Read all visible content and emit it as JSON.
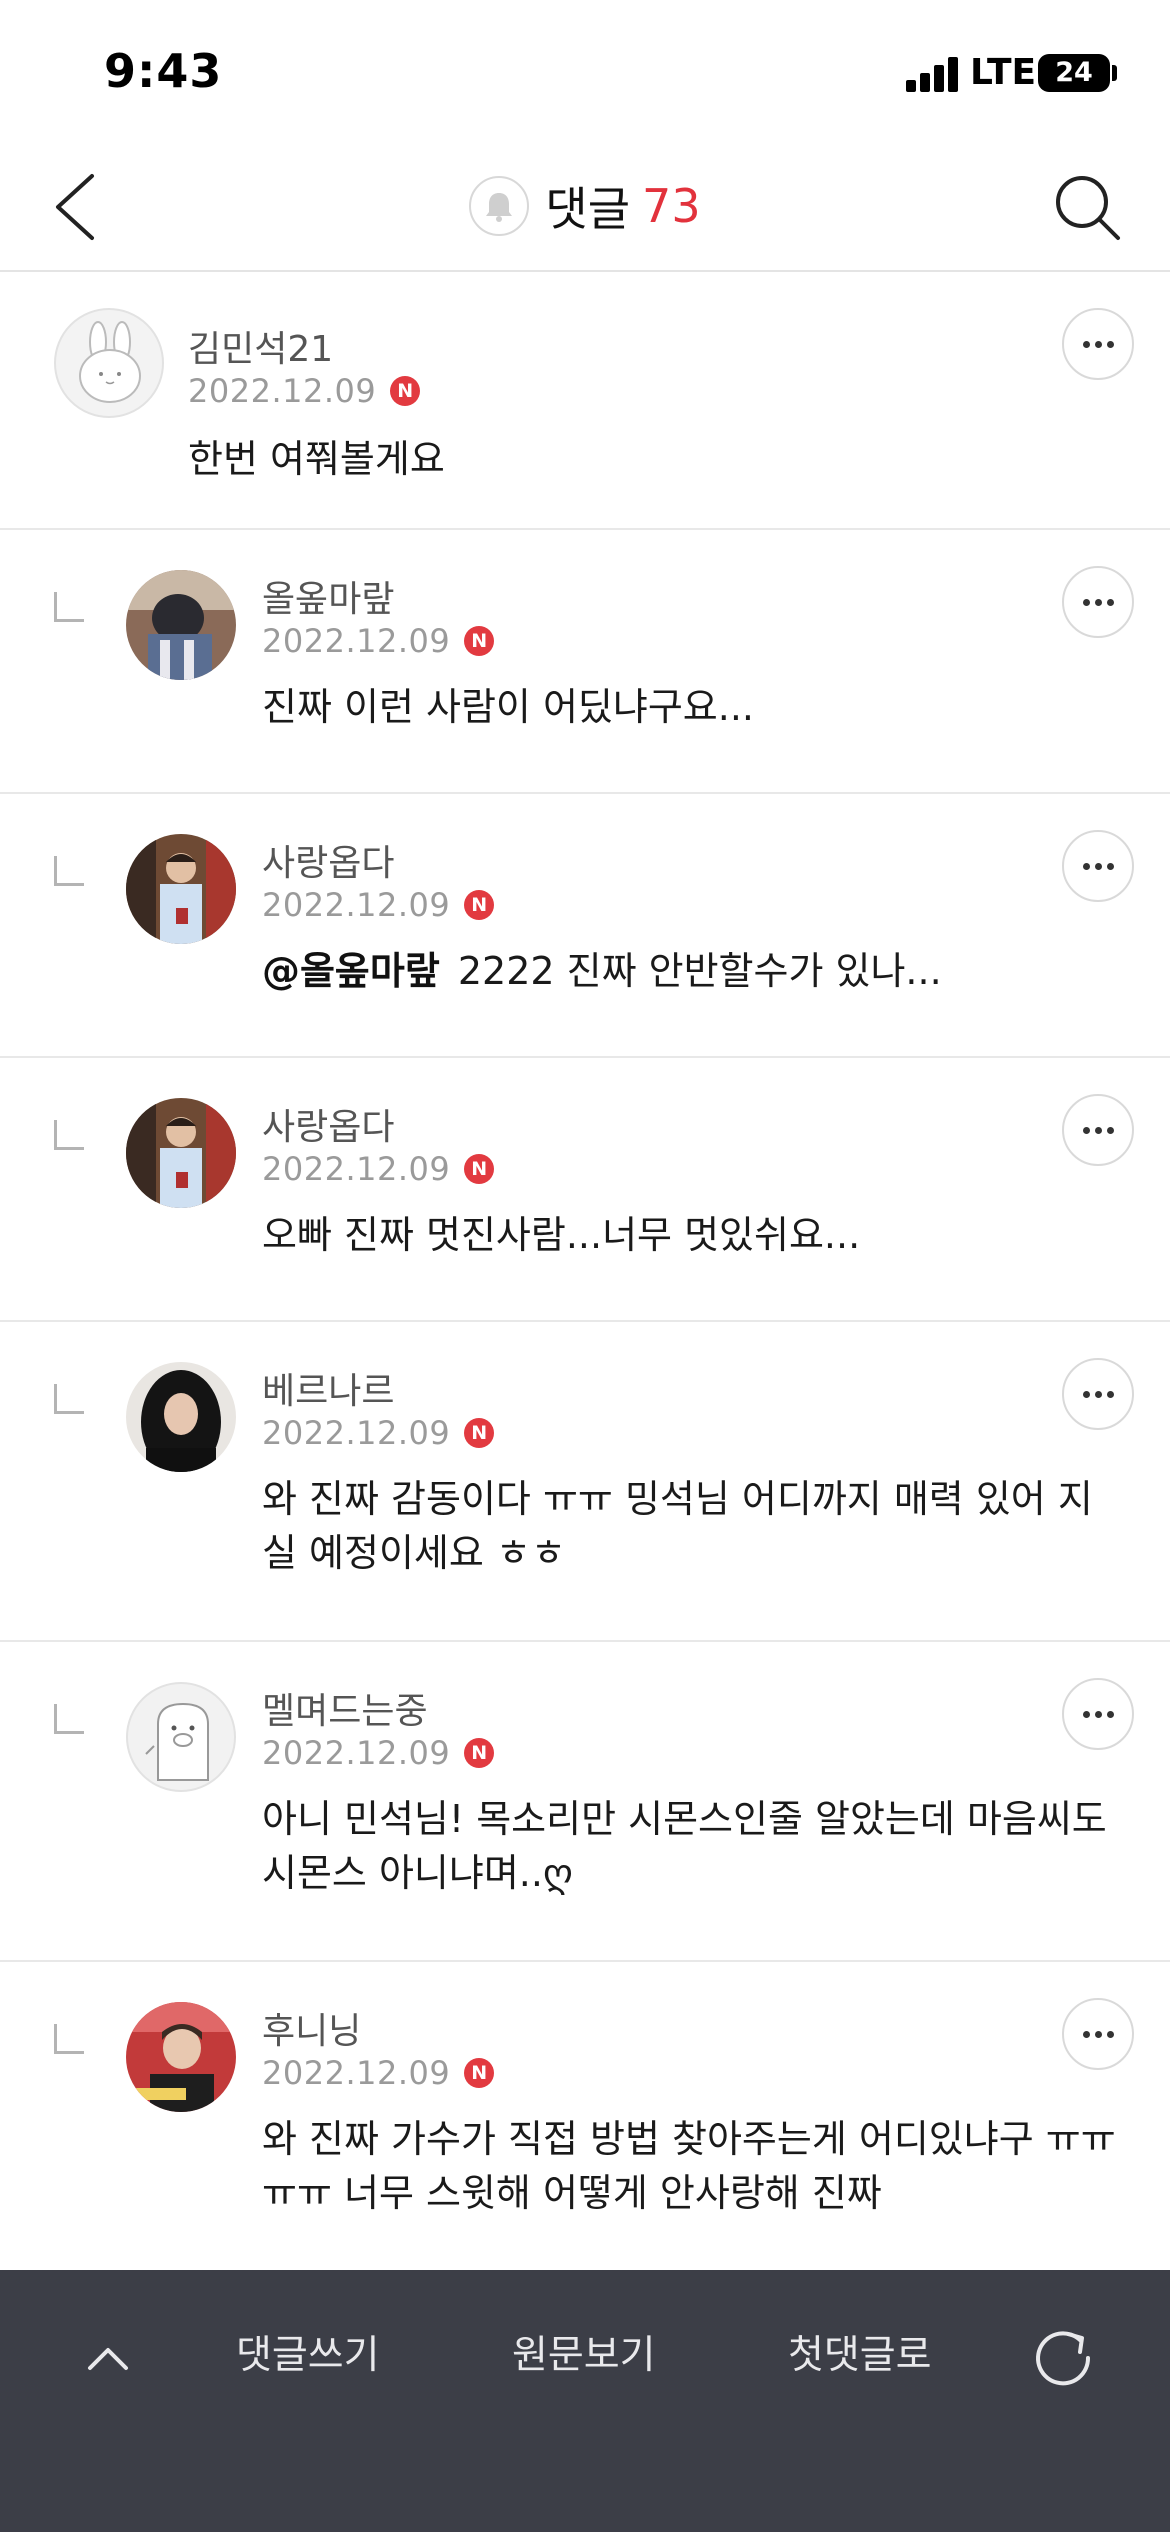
{
  "status_bar": {
    "time": "9:43",
    "network": "LTE",
    "battery": "24"
  },
  "header": {
    "title": "댓글",
    "count": "73"
  },
  "comments": [
    {
      "author": "김민석21",
      "date": "2022.12.09",
      "badge": "N",
      "text": "한번 여쭤볼게요",
      "is_reply": false
    },
    {
      "author": "올옾마랖",
      "date": "2022.12.09",
      "badge": "N",
      "text": "진짜 이런 사람이 어딨냐구요...",
      "is_reply": true
    },
    {
      "author": "사랑옵다",
      "date": "2022.12.09",
      "badge": "N",
      "mention": "@올옾마랖",
      "text": "2222 진짜 안반할수가 있나...",
      "is_reply": true
    },
    {
      "author": "사랑옵다",
      "date": "2022.12.09",
      "badge": "N",
      "text": "오빠 진짜 멋진사람...너무 멋있쉬요...",
      "is_reply": true
    },
    {
      "author": "베르나르",
      "date": "2022.12.09",
      "badge": "N",
      "text": "와 진짜 감동이다 ㅠㅠ 밍석님 어디까지 매력 있어 지실 예정이세요 ㅎㅎ",
      "is_reply": true
    },
    {
      "author": "멜며드는중",
      "date": "2022.12.09",
      "badge": "N",
      "text": "아니 민석님! 목소리만 시몬스인줄 알았는데 마음씨도 시몬스 아니냐며..ღ",
      "is_reply": true
    },
    {
      "author": "후니닝",
      "date": "2022.12.09",
      "badge": "N",
      "text": "와 진짜 가수가 직접 방법 찾아주는게 어디있냐구 ㅠㅠㅠㅠ 너무 스윗해 어떻게 안사랑해 진짜",
      "is_reply": true
    }
  ],
  "bottom_bar": {
    "write_label": "댓글쓰기",
    "original_label": "원문보기",
    "first_label": "첫댓글로"
  },
  "icons": {
    "back": "chevron-left-icon",
    "bell": "bell-icon",
    "search": "search-icon",
    "more": "more-icon",
    "up": "chevron-up-icon",
    "refresh": "refresh-icon"
  },
  "colors": {
    "accent": "#e2323c",
    "bar_bg": "#3c3e47"
  }
}
